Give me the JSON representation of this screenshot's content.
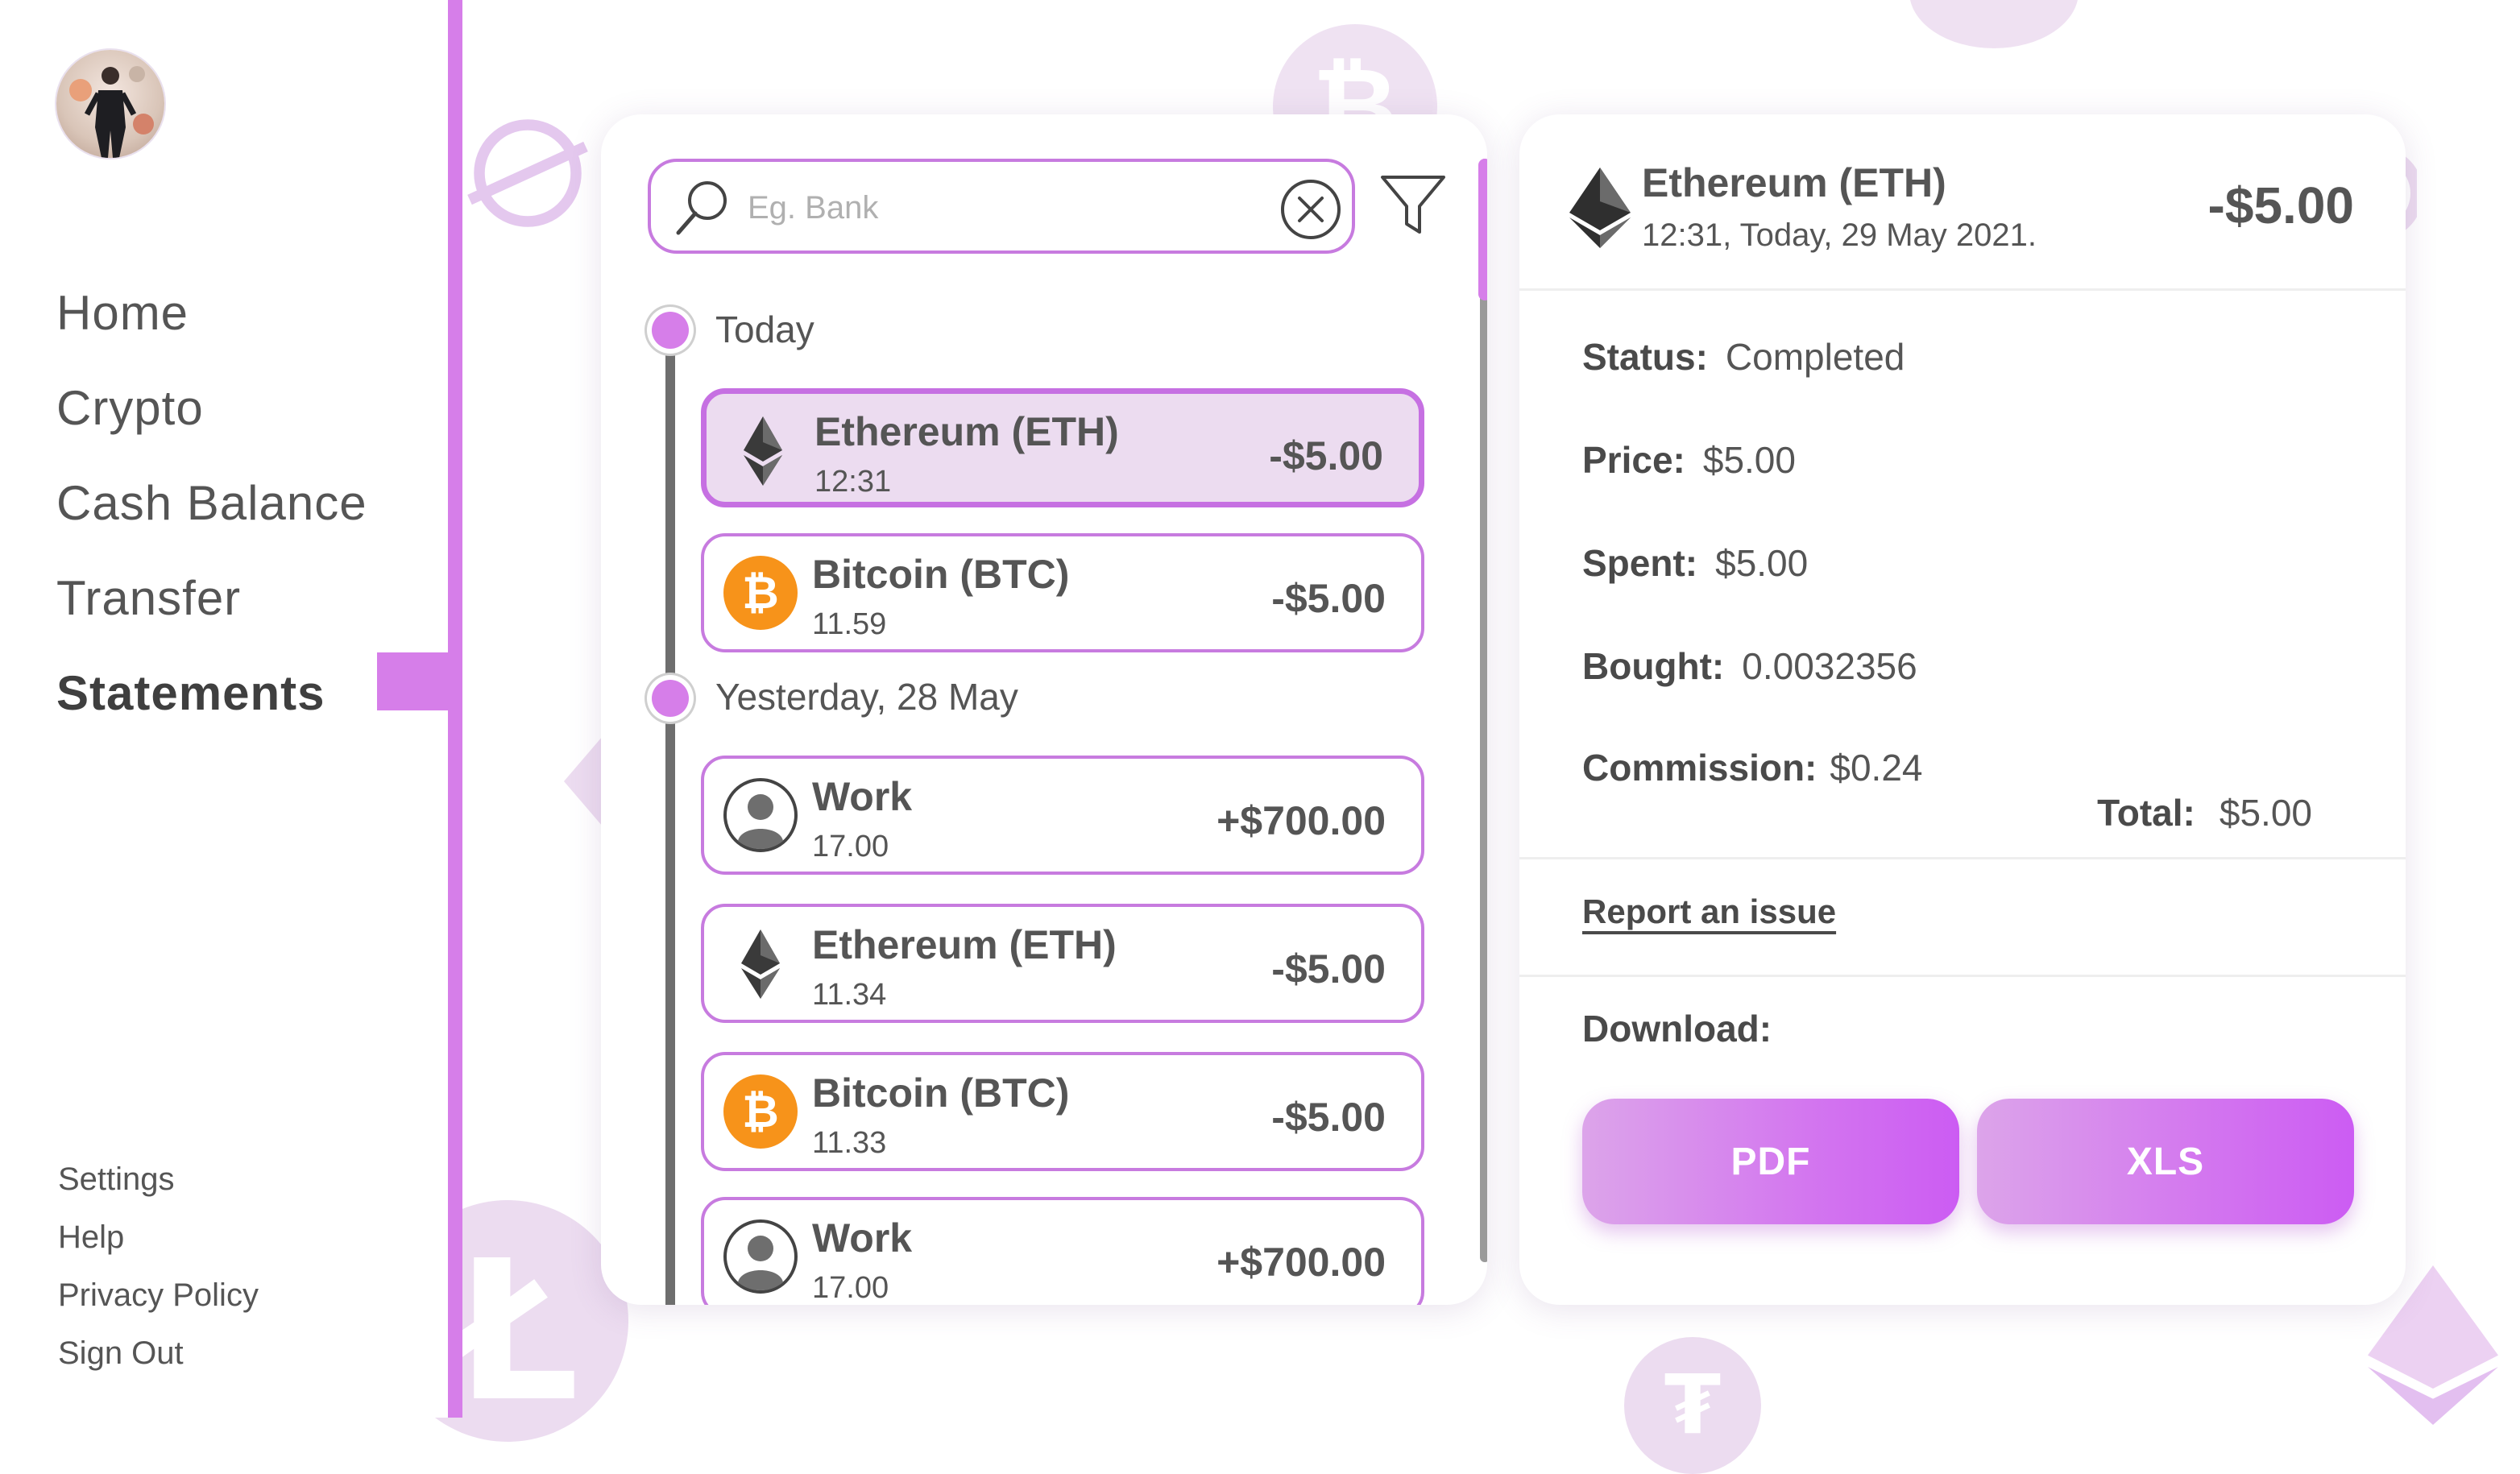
{
  "sidebar": {
    "avatar_alt": "",
    "nav": [
      "Home",
      "Crypto",
      "Cash Balance",
      "Transfer",
      "Statements"
    ],
    "active_index": 4,
    "footer": [
      "Settings",
      "Help",
      "Privacy Policy",
      "Sign Out"
    ]
  },
  "search": {
    "placeholder": "Eg. Bank",
    "value": ""
  },
  "groups": [
    {
      "label": "Today",
      "transactions": [
        {
          "name": "Ethereum (ETH)",
          "time": "12:31",
          "amount": "-$5.00",
          "icon": "ethereum-icon",
          "selected": true
        },
        {
          "name": "Bitcoin (BTC)",
          "time": "11.59",
          "amount": "-$5.00",
          "icon": "bitcoin-icon"
        }
      ]
    },
    {
      "label": "Yesterday, 28 May",
      "transactions": [
        {
          "name": "Work",
          "time": "17.00",
          "amount": "+$700.00",
          "icon": "user-icon"
        },
        {
          "name": "Ethereum (ETH)",
          "time": "11.34",
          "amount": "-$5.00",
          "icon": "ethereum-icon"
        },
        {
          "name": "Bitcoin (BTC)",
          "time": "11.33",
          "amount": "-$5.00",
          "icon": "bitcoin-icon"
        },
        {
          "name": "Work",
          "time": "17.00",
          "amount": "+$700.00",
          "icon": "user-icon"
        }
      ]
    }
  ],
  "detail": {
    "title": "Ethereum (ETH)",
    "subtitle": "12:31, Today, 29 May 2021.",
    "amount": "-$5.00",
    "fields": [
      {
        "label": "Status:",
        "value": "Completed"
      },
      {
        "label": "Price:",
        "value": "$5.00"
      },
      {
        "label": "Spent:",
        "value": "$5.00"
      },
      {
        "label": "Bought:",
        "value": "0.0032356"
      },
      {
        "label": "Commission:",
        "value": "$0.24"
      }
    ],
    "total_label": "Total:",
    "total_value": "$5.00",
    "report_link": "Report an issue",
    "download_label": "Download:",
    "buttons": {
      "pdf": "PDF",
      "xls": "XLS"
    }
  },
  "colors": {
    "accent": "#d67ee9",
    "accent_light": "#ecdcf0",
    "text": "#555555",
    "bitcoin": "#f7931a"
  }
}
